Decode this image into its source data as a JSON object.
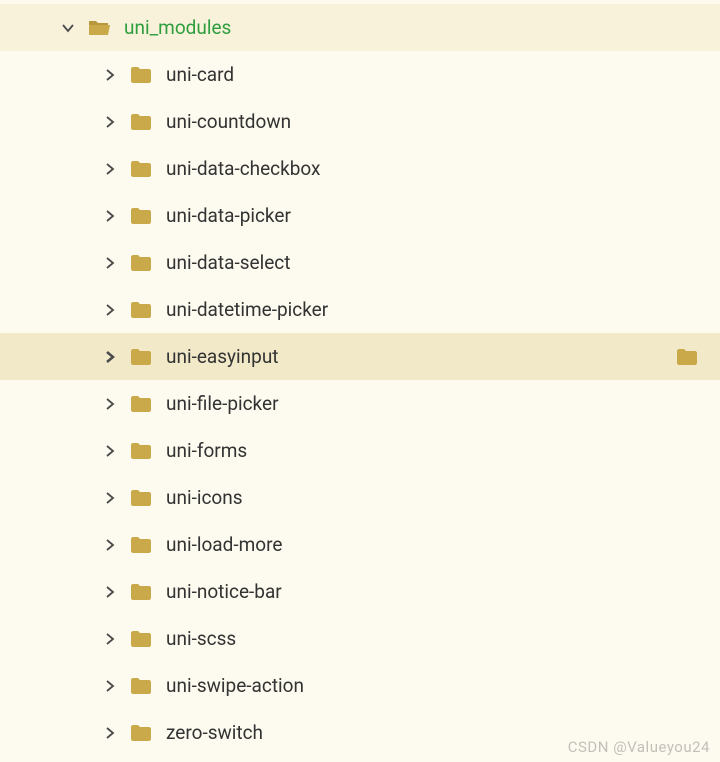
{
  "root": {
    "label": "uni_modules"
  },
  "children": [
    {
      "label": "uni-card",
      "highlighted": false
    },
    {
      "label": "uni-countdown",
      "highlighted": false
    },
    {
      "label": "uni-data-checkbox",
      "highlighted": false
    },
    {
      "label": "uni-data-picker",
      "highlighted": false
    },
    {
      "label": "uni-data-select",
      "highlighted": false
    },
    {
      "label": "uni-datetime-picker",
      "highlighted": false
    },
    {
      "label": "uni-easyinput",
      "highlighted": true
    },
    {
      "label": "uni-file-picker",
      "highlighted": false
    },
    {
      "label": "uni-forms",
      "highlighted": false
    },
    {
      "label": "uni-icons",
      "highlighted": false
    },
    {
      "label": "uni-load-more",
      "highlighted": false
    },
    {
      "label": "uni-notice-bar",
      "highlighted": false
    },
    {
      "label": "uni-scss",
      "highlighted": false
    },
    {
      "label": "uni-swipe-action",
      "highlighted": false
    },
    {
      "label": "zero-switch",
      "highlighted": false
    }
  ],
  "watermark": "CSDN @Valueyou24",
  "colors": {
    "folder": "#c9a94a",
    "folderOpen": "#c9a94a"
  }
}
